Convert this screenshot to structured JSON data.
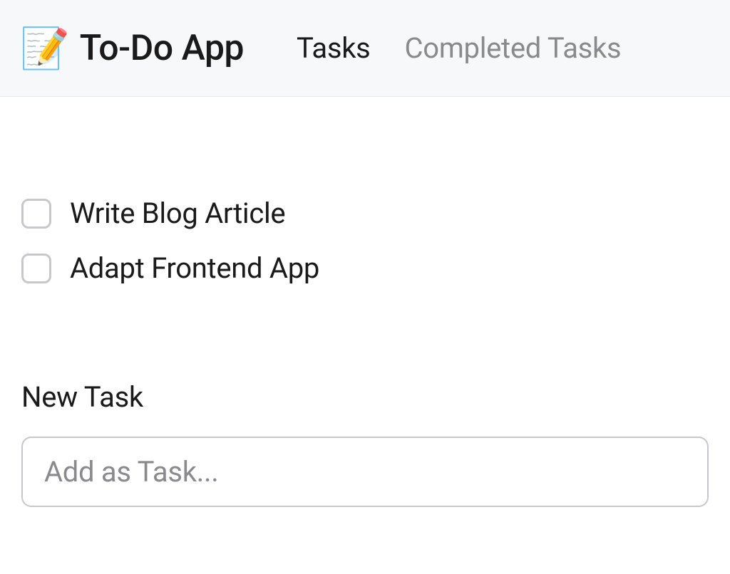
{
  "header": {
    "icon": "📝",
    "title": "To-Do App",
    "tabs": [
      {
        "label": "Tasks",
        "active": true
      },
      {
        "label": "Completed Tasks",
        "active": false
      }
    ]
  },
  "tasks": [
    {
      "label": "Write Blog Article",
      "checked": false
    },
    {
      "label": "Adapt Frontend App",
      "checked": false
    }
  ],
  "newTask": {
    "label": "New Task",
    "placeholder": "Add as Task..."
  }
}
